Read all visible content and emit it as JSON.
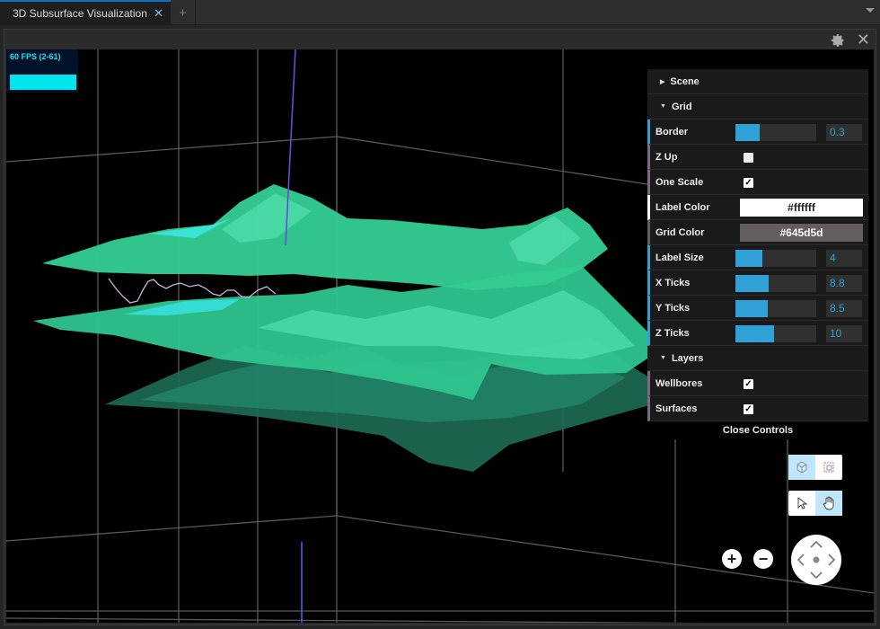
{
  "tab": {
    "title": "3D Subsurface Visualization",
    "close": "✕",
    "add": "+"
  },
  "panel": {
    "close": "✕"
  },
  "fps": {
    "label": "60 FPS (2-61)",
    "level_fraction": 1.0
  },
  "gui": {
    "scene_label": "Scene",
    "grid_label": "Grid",
    "layers_label": "Layers",
    "close_label": "Close Controls",
    "border": {
      "label": "Border",
      "value": "0.3",
      "fraction": 0.3
    },
    "z_up": {
      "label": "Z Up",
      "checked": false
    },
    "one_scale": {
      "label": "One Scale",
      "checked": true
    },
    "label_color": {
      "label": "Label Color",
      "value": "#ffffff"
    },
    "grid_color": {
      "label": "Grid Color",
      "value": "#645d5d"
    },
    "label_size": {
      "label": "Label Size",
      "value": "4",
      "fraction": 0.33
    },
    "x_ticks": {
      "label": "X Ticks",
      "value": "8.8",
      "fraction": 0.41
    },
    "y_ticks": {
      "label": "Y Ticks",
      "value": "8.5",
      "fraction": 0.4
    },
    "z_ticks": {
      "label": "Z Ticks",
      "value": "10",
      "fraction": 0.48
    },
    "wellbores": {
      "label": "Wellbores",
      "checked": true
    },
    "surfaces": {
      "label": "Surfaces",
      "checked": true
    }
  },
  "colors": {
    "accent": "#2fa1d6",
    "surface": "#3cd39a",
    "fps": "#00e5ee"
  },
  "icons": [
    "gear-icon",
    "close-icon",
    "cube-view-icon",
    "box-select-icon",
    "pointer-icon",
    "hand-pan-icon",
    "zoom-in-icon",
    "zoom-out-icon",
    "nav-pad-icon"
  ]
}
